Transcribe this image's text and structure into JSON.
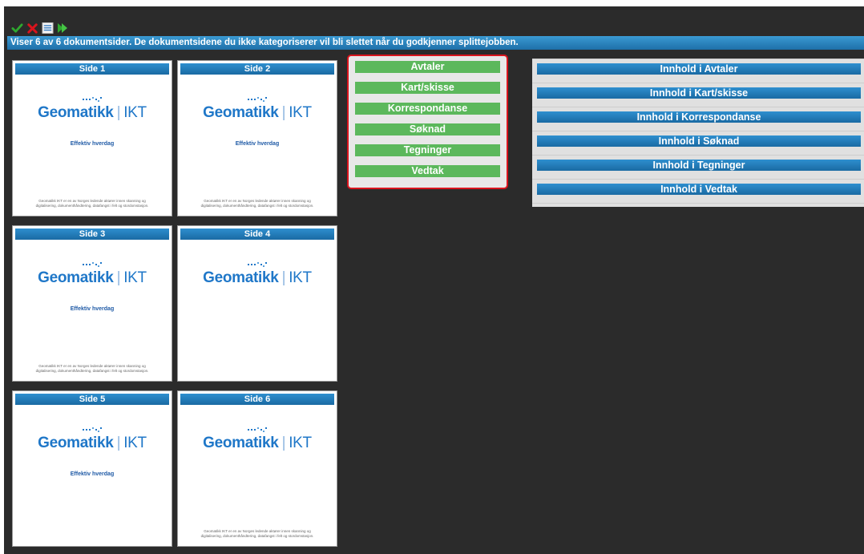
{
  "toolbar": {
    "buttons": [
      {
        "icon": "checkmark-icon",
        "color": "#2fa82f"
      },
      {
        "icon": "x-icon",
        "color": "#d9141d"
      },
      {
        "icon": "document-list-icon",
        "color": "#eeeeee"
      },
      {
        "icon": "play-forward-icon",
        "color": "#2fa82f"
      }
    ]
  },
  "info": {
    "message": "Viser 6 av 6 dokumentsider. De dokumentsidene du ikke kategoriserer vil bli slettet når du godkjenner splittejobben."
  },
  "pages": [
    {
      "label": "Side 1",
      "logo_name": "Geomatikk",
      "logo_suffix": "IKT",
      "tagline": "Effektiv hverdag",
      "footer": "Geomatikk IKT er en av Norges ledende aktører innen skanning og digitalisering, dokumenthåndtering, datafangst i felt og stordomstasjon."
    },
    {
      "label": "Side 2",
      "logo_name": "Geomatikk",
      "logo_suffix": "IKT",
      "tagline": "Effektiv hverdag",
      "footer": "Geomatikk IKT er en av Norges ledende aktører innen skanning og digitalisering, dokumenthåndtering, datafangst i felt og stordomstasjon."
    },
    {
      "label": "Side 3",
      "logo_name": "Geomatikk",
      "logo_suffix": "IKT",
      "tagline": "Effektiv hverdag",
      "footer": "Geomatikk IKT er en av Norges ledende aktører innen skanning og digitalisering, dokumenthåndtering, datafangst i felt og stordomstasjon."
    },
    {
      "label": "Side 4",
      "logo_name": "Geomatikk",
      "logo_suffix": "IKT",
      "tagline": "",
      "footer": ""
    },
    {
      "label": "Side 5",
      "logo_name": "Geomatikk",
      "logo_suffix": "IKT",
      "tagline": "Effektiv hverdag",
      "footer": ""
    },
    {
      "label": "Side 6",
      "logo_name": "Geomatikk",
      "logo_suffix": "IKT",
      "tagline": "",
      "footer": "Geomatikk IKT er en av Norges ledende aktører innen skanning og digitalisering, dokumenthåndtering, datafangst i felt og stordomstasjon."
    }
  ],
  "categories": [
    "Avtaler",
    "Kart/skisse",
    "Korrespondanse",
    "Søknad",
    "Tegninger",
    "Vedtak"
  ],
  "content_sections": [
    "Innhold i Avtaler",
    "Innhold i Kart/skisse",
    "Innhold i Korrespondanse",
    "Innhold i Søknad",
    "Innhold i Tegninger",
    "Innhold i Vedtak"
  ],
  "colors": {
    "accent_blue": "#1e6fa8",
    "category_green": "#5cb85c",
    "highlight_red": "#d9141d",
    "logo_blue": "#1f77c8",
    "background_dark": "#2b2b2b"
  }
}
